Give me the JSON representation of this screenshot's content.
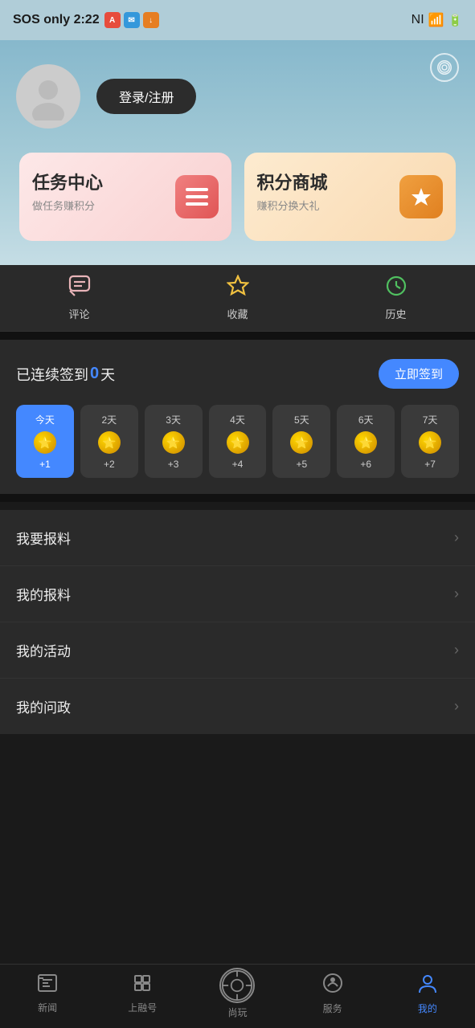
{
  "statusBar": {
    "sosText": "SOS only 2:22",
    "timeText": "2:22"
  },
  "header": {
    "loginBtn": "登录/注册",
    "cameraLabel": "camera"
  },
  "cards": [
    {
      "id": "task-center",
      "title": "任务中心",
      "subtitle": "做任务赚积分",
      "icon": "≡"
    },
    {
      "id": "shop",
      "title": "积分商城",
      "subtitle": "赚积分换大礼",
      "icon": "★"
    }
  ],
  "tabs": [
    {
      "id": "comment",
      "label": "评论",
      "icon": "💬"
    },
    {
      "id": "favorites",
      "label": "收藏",
      "icon": "☆"
    },
    {
      "id": "history",
      "label": "历史",
      "icon": "🕐"
    }
  ],
  "signin": {
    "prefixText": "已连续签到",
    "countText": "0",
    "suffixText": "天",
    "btnLabel": "立即签到",
    "days": [
      {
        "label": "今天",
        "points": "+1",
        "today": true
      },
      {
        "label": "2天",
        "points": "+2",
        "today": false
      },
      {
        "label": "3天",
        "points": "+3",
        "today": false
      },
      {
        "label": "4天",
        "points": "+4",
        "today": false
      },
      {
        "label": "5天",
        "points": "+5",
        "today": false
      },
      {
        "label": "6天",
        "points": "+6",
        "today": false
      },
      {
        "label": "7天",
        "points": "+7",
        "today": false
      }
    ]
  },
  "menu": [
    {
      "id": "report-create",
      "label": "我要报料"
    },
    {
      "id": "my-reports",
      "label": "我的报料"
    },
    {
      "id": "my-activities",
      "label": "我的活动"
    },
    {
      "id": "my-questions",
      "label": "我的问政"
    }
  ],
  "bottomNav": [
    {
      "id": "news",
      "label": "新闻",
      "active": false
    },
    {
      "id": "ronghe",
      "label": "上融号",
      "active": false
    },
    {
      "id": "play",
      "label": "尚玩",
      "active": false,
      "center": true
    },
    {
      "id": "service",
      "label": "服务",
      "active": false
    },
    {
      "id": "mine",
      "label": "我的",
      "active": true
    }
  ]
}
